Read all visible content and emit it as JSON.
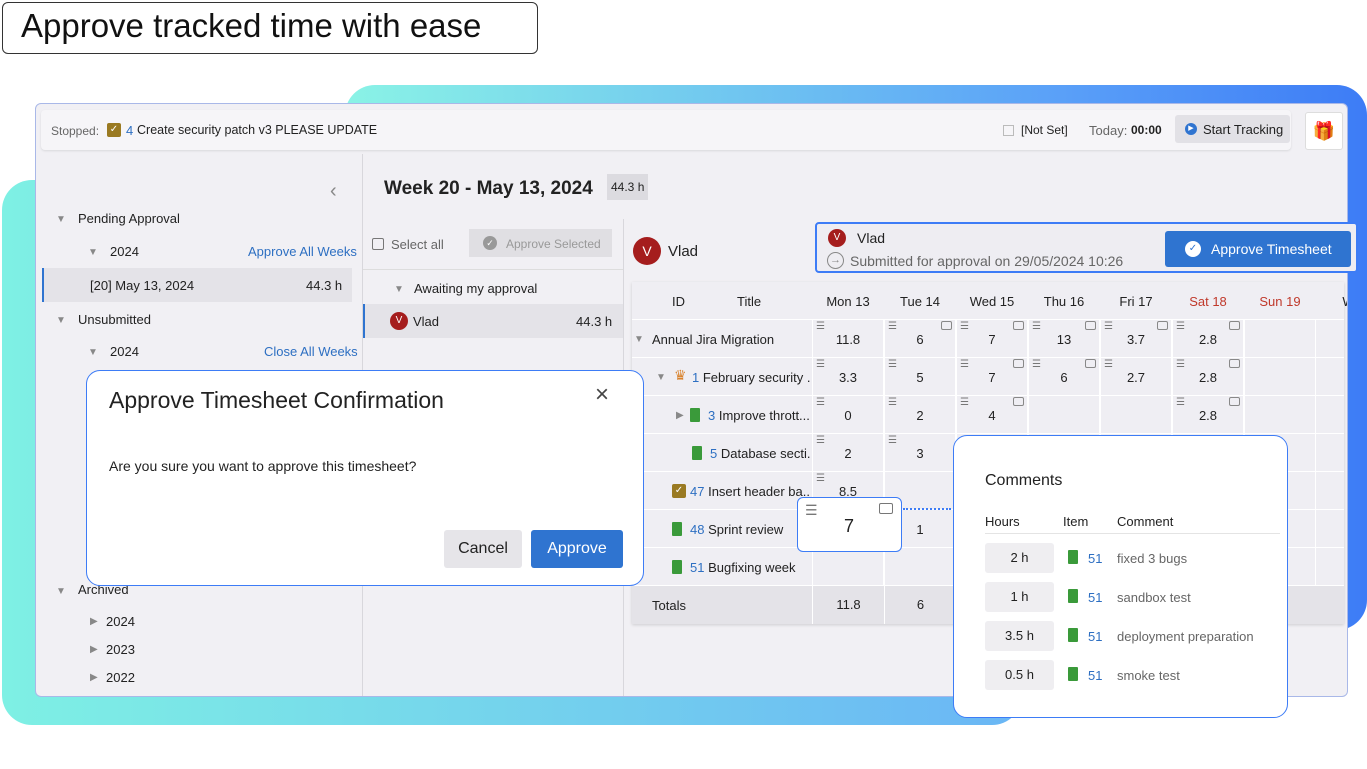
{
  "hero_title": "Approve tracked time with ease",
  "toolbar": {
    "stopped_label": "Stopped:",
    "task_id": "4",
    "task_title": "Create security patch v3 PLEASE UPDATE",
    "not_set": "[Not Set]",
    "today_label": "Today:",
    "today_value": "00:00",
    "start_tracking": "Start Tracking"
  },
  "sidebar": {
    "pending": "Pending Approval",
    "pending_year": "2024",
    "approve_all": "Approve All Weeks",
    "week_item": "[20] May 13, 2024",
    "week_hours": "44.3 h",
    "unsubmitted": "Unsubmitted",
    "unsub_year": "2024",
    "close_all": "Close All Weeks",
    "archived": "Archived",
    "archived_years": [
      "2024",
      "2023",
      "2022"
    ]
  },
  "week": {
    "title": "Week 20  -  May 13, 2024",
    "hours": "44.3 h"
  },
  "middle": {
    "select_all": "Select all",
    "approve_selected": "Approve Selected",
    "group": "Awaiting my approval",
    "user_initial": "V",
    "user": "Vlad",
    "user_hours": "44.3 h"
  },
  "detail": {
    "user_initial": "V",
    "user": "Vlad",
    "card_user": "Vlad",
    "submitted": "Submitted for approval on 29/05/2024 10:26",
    "approve_timesheet": "Approve Timesheet"
  },
  "grid": {
    "headers": [
      "ID",
      "Title",
      "Mon 13",
      "Tue 14",
      "Wed 15",
      "Thu 16",
      "Fri 17",
      "Sat 18",
      "Sun 19",
      "We"
    ],
    "weekend_color": "#c0392b",
    "rows": [
      {
        "id": "",
        "title": "Annual Jira Migration",
        "cells": [
          "11.8",
          "6",
          "7",
          "13",
          "3.7",
          "2.8",
          ""
        ]
      },
      {
        "id": "1",
        "title": "February security ...",
        "cells": [
          "3.3",
          "5",
          "7",
          "6",
          "2.7",
          "2.8",
          ""
        ]
      },
      {
        "id": "3",
        "title": "Improve thrott...",
        "cells": [
          "0",
          "2",
          "4",
          "",
          "",
          "2.8",
          ""
        ]
      },
      {
        "id": "5",
        "title": "Database secti...",
        "cells": [
          "2",
          "3",
          "",
          "",
          "",
          "",
          ""
        ]
      },
      {
        "id": "47",
        "title": "Insert header ba...",
        "cells": [
          "8.5",
          "",
          "",
          "",
          "",
          "",
          ""
        ]
      },
      {
        "id": "48",
        "title": "Sprint review",
        "cells": [
          "",
          "1",
          "",
          "",
          "",
          "",
          ""
        ]
      },
      {
        "id": "51",
        "title": "Bugfixing week",
        "cells": [
          "",
          "",
          "",
          "",
          "",
          "",
          ""
        ]
      }
    ],
    "totals_label": "Totals",
    "totals": [
      "11.8",
      "6"
    ]
  },
  "cell_popup": {
    "value": "7"
  },
  "dialog": {
    "title": "Approve Timesheet Confirmation",
    "message": "Are you sure you want to approve this timesheet?",
    "cancel": "Cancel",
    "approve": "Approve"
  },
  "comments": {
    "title": "Comments",
    "headers": [
      "Hours",
      "Item",
      "Comment"
    ],
    "rows": [
      {
        "hours": "2 h",
        "item": "51",
        "comment": "fixed 3 bugs"
      },
      {
        "hours": "1 h",
        "item": "51",
        "comment": "sandbox test"
      },
      {
        "hours": "3.5 h",
        "item": "51",
        "comment": "deployment preparation"
      },
      {
        "hours": "0.5 h",
        "item": "51",
        "comment": "smoke test"
      }
    ]
  }
}
